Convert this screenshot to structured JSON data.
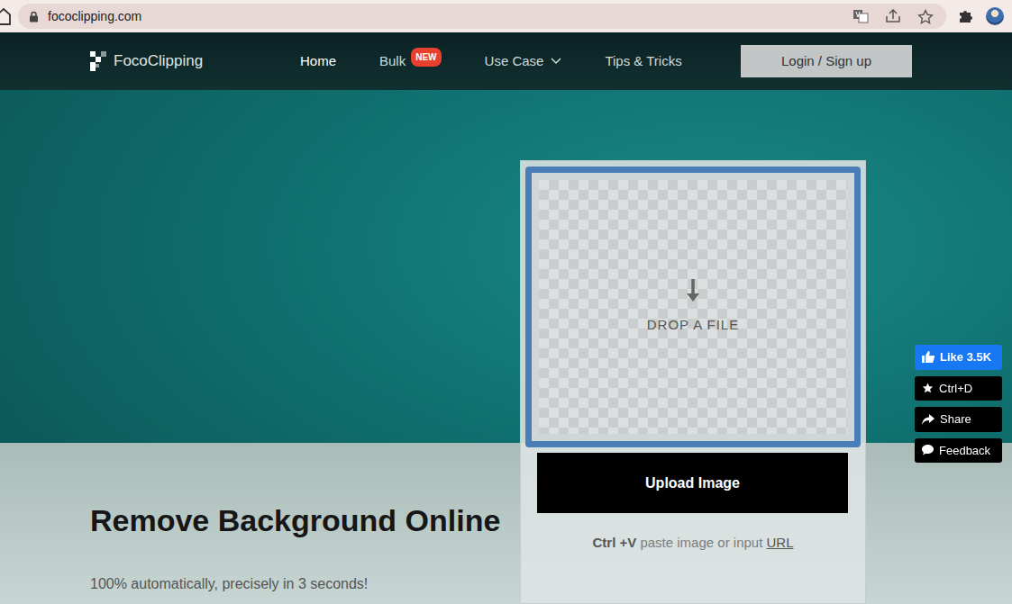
{
  "browser": {
    "url": "fococlipping.com"
  },
  "nav": {
    "brand": "FocoClipping",
    "items": [
      {
        "label": "Home",
        "selected": true,
        "kind": "link"
      },
      {
        "label": "Bulk",
        "badge": "NEW",
        "selected": false,
        "kind": "link"
      },
      {
        "label": "Use Case",
        "selected": false,
        "kind": "dropdown"
      },
      {
        "label": "Tips & Tricks",
        "selected": false,
        "kind": "link"
      }
    ],
    "login": "Login / Sign up"
  },
  "upload": {
    "drop_label": "DROP A FILE",
    "button": "Upload Image",
    "hint_keys": "Ctrl +V",
    "hint_text": "paste image or input",
    "hint_link": "URL"
  },
  "hero": {
    "title": "Remove Background Online",
    "subtitle": "100% automatically, precisely in 3 seconds!"
  },
  "side_buttons": [
    {
      "label": "Like",
      "count": "3.5K",
      "kind": "facebook"
    },
    {
      "label": "Ctrl+D",
      "kind": "bookmark"
    },
    {
      "label": "Share",
      "kind": "share"
    },
    {
      "label": "Feedback",
      "kind": "feedback"
    }
  ]
}
